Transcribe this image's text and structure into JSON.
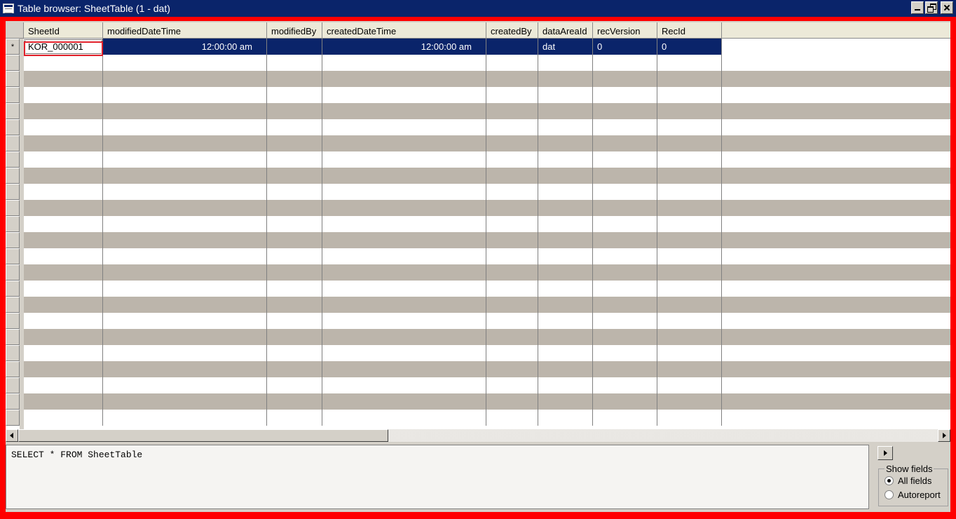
{
  "window": {
    "title": "Table browser: SheetTable (1 - dat)"
  },
  "grid": {
    "columns": [
      "SheetId",
      "modifiedDateTime",
      "modifiedBy",
      "createdDateTime",
      "createdBy",
      "dataAreaId",
      "recVersion",
      "RecId"
    ],
    "row_marker": "*",
    "rows": [
      {
        "SheetId": "KOR_000001",
        "modifiedDateTime": "12:00:00 am",
        "modifiedBy": "",
        "createdDateTime": "12:00:00 am",
        "createdBy": "",
        "dataAreaId": "dat",
        "recVersion": "0",
        "RecId": "0"
      }
    ]
  },
  "query": {
    "text": "SELECT * FROM SheetTable"
  },
  "show_fields": {
    "legend": "Show fields",
    "options": [
      {
        "label": "All fields",
        "checked": true
      },
      {
        "label": "Autoreport",
        "checked": false
      }
    ]
  },
  "colors": {
    "titlebar": "#0a246a",
    "selection": "#0a246a",
    "alt_row": "#bcb5ab",
    "frame": "#ff0000"
  }
}
